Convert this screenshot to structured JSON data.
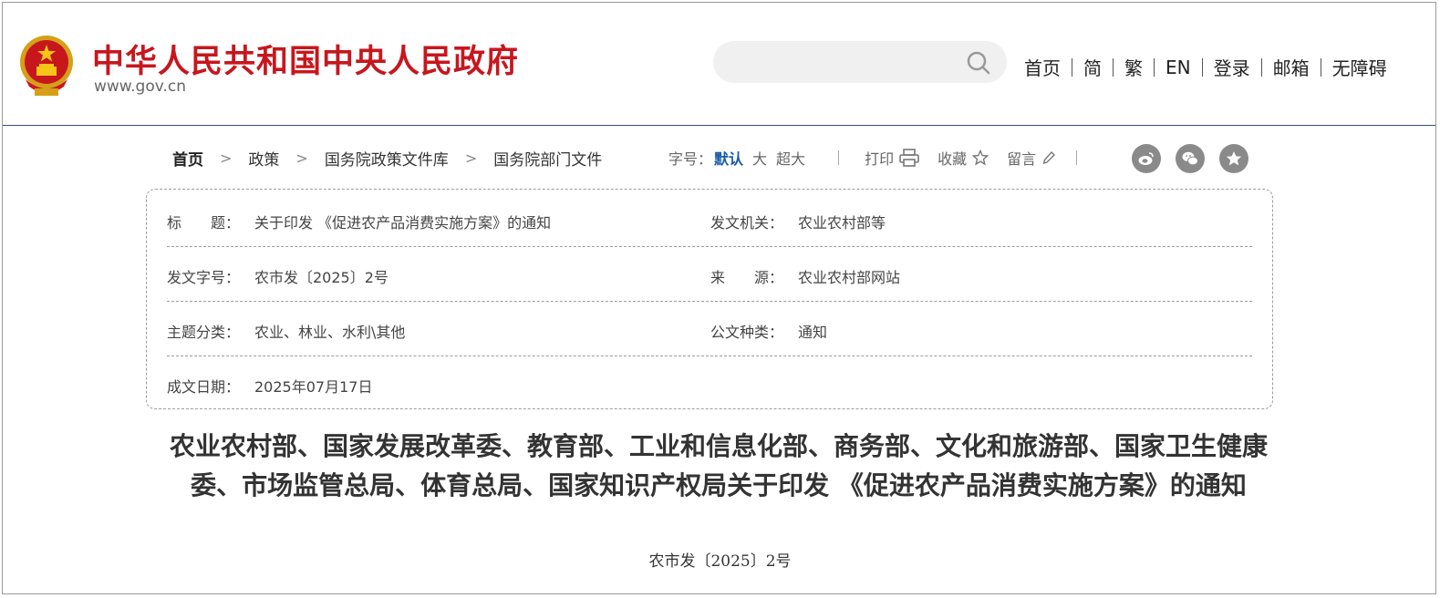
{
  "header": {
    "site_title": "中华人民共和国中央人民政府",
    "site_url": "www.gov.cn",
    "search": {
      "placeholder": "",
      "value": ""
    },
    "nav": [
      {
        "label": "首页"
      },
      {
        "label": "简"
      },
      {
        "label": "繁"
      },
      {
        "label": "EN"
      },
      {
        "label": "登录"
      },
      {
        "label": "邮箱"
      },
      {
        "label": "无障碍"
      }
    ]
  },
  "breadcrumb": [
    "首页",
    "政策",
    "国务院政策文件库",
    "国务院部门文件"
  ],
  "tools": {
    "font_size_label": "字号：",
    "font_sizes": [
      "默认",
      "大",
      "超大"
    ],
    "print": "打印",
    "favorite": "收藏",
    "comment": "留言"
  },
  "share_icons": [
    "weibo-icon",
    "wechat-icon",
    "favorite-star-icon"
  ],
  "info": {
    "title_label": "标　　题：",
    "title_value": "关于印发 《促进农产品消费实施方案》的通知",
    "issuer_label": "发文机关：",
    "issuer_value": "农业农村部等",
    "doc_no_label": "发文字号：",
    "doc_no_value": "农市发〔2025〕2号",
    "source_label": "来　　源：",
    "source_value": "农业农村部网站",
    "category_label": "主题分类：",
    "category_value": "农业、林业、水利\\其他",
    "doc_type_label": "公文种类：",
    "doc_type_value": "通知",
    "date_label": "成文日期：",
    "date_value": "2025年07月17日"
  },
  "document": {
    "title": "农业农村部、国家发展改革委、教育部、工业和信息化部、商务部、文化和旅游部、国家卫生健康委、市场监管总局、体育总局、国家知识产权局关于印发 《促进农产品消费实施方案》的通知",
    "number": "农市发〔2025〕2号"
  },
  "colors": {
    "brand_red": "#c8161d",
    "active_blue": "#1a5ba8",
    "header_rule": "#2e4e7a"
  }
}
